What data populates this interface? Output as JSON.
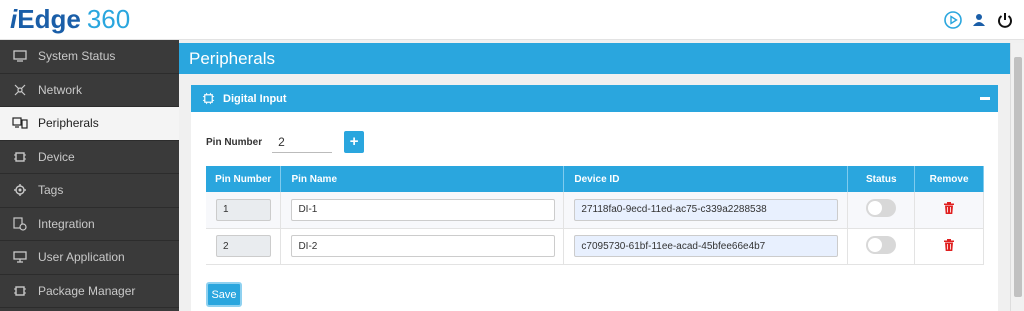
{
  "app": {
    "logo_i": "i",
    "logo_edge": "Edge",
    "logo_version": "360"
  },
  "header_icons": [
    "play-circle-icon",
    "user-icon",
    "power-icon"
  ],
  "sidebar": {
    "items": [
      {
        "label": "System Status",
        "icon": "monitor-icon"
      },
      {
        "label": "Network",
        "icon": "network-icon"
      },
      {
        "label": "Peripherals",
        "icon": "peripherals-icon",
        "active": true
      },
      {
        "label": "Device",
        "icon": "chip-icon"
      },
      {
        "label": "Tags",
        "icon": "tag-gear-icon"
      },
      {
        "label": "Integration",
        "icon": "integration-icon"
      },
      {
        "label": "User Application",
        "icon": "desktop-icon"
      },
      {
        "label": "Package Manager",
        "icon": "package-icon"
      }
    ]
  },
  "page": {
    "title": "Peripherals"
  },
  "panel": {
    "title": "Digital Input",
    "pin_number_label": "Pin Number",
    "pin_number_value": "2",
    "add_label": "+",
    "save_label": "Save"
  },
  "table": {
    "headers": [
      "Pin Number",
      "Pin Name",
      "Device ID",
      "Status",
      "Remove"
    ],
    "rows": [
      {
        "pin": "1",
        "name": "DI-1",
        "device_id": "27118fa0-9ecd-11ed-ac75-c339a2288538",
        "status": false
      },
      {
        "pin": "2",
        "name": "DI-2",
        "device_id": "c7095730-61bf-11ee-acad-45bfee66e4b7",
        "status": false
      }
    ]
  },
  "colors": {
    "accent": "#2aa6de",
    "sidebar": "#3a3a3a",
    "danger": "#e02020"
  }
}
